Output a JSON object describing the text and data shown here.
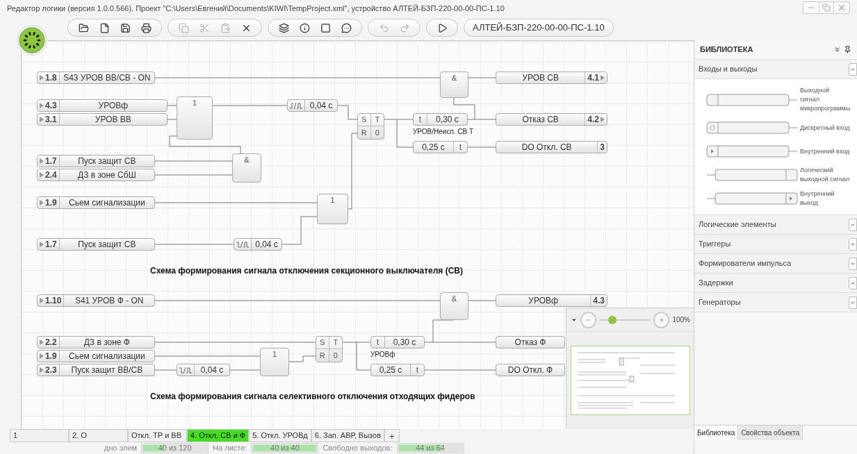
{
  "window": {
    "title": "Редактор логики (версия 1.0.0.566). Проект \"C:\\Users\\Евгений\\Documents\\KIWI\\TempProject.xml\", устройство АЛТЕЙ-БЗП-220-00-00-ПС-1.10"
  },
  "toolbar": {
    "groups": [
      {
        "buttons": [
          {
            "kind": "open",
            "disabled": false
          },
          {
            "kind": "new",
            "disabled": false
          },
          {
            "kind": "save",
            "disabled": false
          },
          {
            "kind": "print",
            "disabled": false
          }
        ]
      },
      {
        "buttons": [
          {
            "kind": "copy",
            "disabled": true
          },
          {
            "kind": "cut",
            "disabled": true
          },
          {
            "kind": "paste",
            "disabled": true
          },
          {
            "kind": "delete",
            "disabled": false
          }
        ]
      },
      {
        "buttons": [
          {
            "kind": "windows",
            "disabled": false
          },
          {
            "kind": "info",
            "disabled": false
          },
          {
            "kind": "frame",
            "disabled": false
          },
          {
            "kind": "comment",
            "disabled": false
          }
        ]
      },
      {
        "buttons": [
          {
            "kind": "undo",
            "disabled": true
          },
          {
            "kind": "redo",
            "disabled": true
          }
        ]
      },
      {
        "buttons": [
          {
            "kind": "run",
            "disabled": false
          }
        ]
      }
    ],
    "device": "АЛТЕЙ-БЗП-220-00-00-ПС-1.10"
  },
  "diagrams": [
    {
      "title": "Схема формирования сигнала отключения секционного выключателя (СВ)",
      "nodes": [
        {
          "kind": "input",
          "number": "1.8",
          "label": "S43 УРОВ ВВ/СВ - ON"
        },
        {
          "kind": "input",
          "number": "4.3",
          "label": "УРОВф"
        },
        {
          "kind": "input",
          "number": "3.1",
          "label": "УРОВ ВВ"
        },
        {
          "kind": "input",
          "number": "1.7",
          "label": "Пуск защит СВ"
        },
        {
          "kind": "input",
          "number": "2.4",
          "label": "ДЗ в зоне СбШ"
        },
        {
          "kind": "input",
          "number": "1.9",
          "label": "Сьем сигнализации"
        },
        {
          "kind": "input",
          "number": "1.7",
          "label": "Пуск защит СВ"
        },
        {
          "kind": "gate",
          "symbol": "1"
        },
        {
          "kind": "gate",
          "symbol": "&"
        },
        {
          "kind": "gate",
          "symbol": "1"
        },
        {
          "kind": "pulse_rising",
          "value": "0,04 с"
        },
        {
          "kind": "pulse_falling",
          "value": "0,04 с"
        },
        {
          "kind": "trigger",
          "cells": [
            "S",
            "T",
            "R",
            "0"
          ]
        },
        {
          "kind": "timer_on",
          "symbol": "t",
          "value": "0,30 с",
          "caption": "УРОВ/Неисп. СВ Т"
        },
        {
          "kind": "timer_off",
          "symbol": "t",
          "value": "0,25 с"
        },
        {
          "kind": "gate",
          "symbol": "&"
        },
        {
          "kind": "output",
          "label": "УРОВ СВ",
          "number": "4.1",
          "arrow": true
        },
        {
          "kind": "output",
          "label": "Отказ СВ",
          "number": "4.2",
          "arrow": true
        },
        {
          "kind": "output",
          "label": "DO Откл. СВ",
          "number": "3",
          "arrow": false
        }
      ]
    },
    {
      "title": "Схема формирования сигнала селективного отключения отходящих фидеров",
      "nodes": [
        {
          "kind": "input",
          "number": "1.10",
          "label": "S41 УРОВ Ф - ON"
        },
        {
          "kind": "input",
          "number": "2.2",
          "label": "ДЗ в зоне Ф"
        },
        {
          "kind": "input",
          "number": "1.9",
          "label": "Сьем сигнализации"
        },
        {
          "kind": "input",
          "number": "2.3",
          "label": "Пуск защит ВВ/СВ"
        },
        {
          "kind": "pulse_falling",
          "value": "0,04 с"
        },
        {
          "kind": "gate",
          "symbol": "1"
        },
        {
          "kind": "trigger",
          "cells": [
            "S",
            "T",
            "R",
            "0"
          ]
        },
        {
          "kind": "timer_on",
          "symbol": "t",
          "value": "0,30 с",
          "caption": "УРОВф"
        },
        {
          "kind": "timer_off",
          "symbol": "t",
          "value": "0,25 с"
        },
        {
          "kind": "gate",
          "symbol": "&"
        },
        {
          "kind": "output",
          "label": "УРОВф",
          "number": "4.3",
          "arrow": false
        },
        {
          "kind": "output",
          "label": "Отказ Ф"
        },
        {
          "kind": "output",
          "label": "DO Откл. Ф"
        }
      ]
    }
  ],
  "navigator": {
    "zoom": "100%",
    "level": 0.2
  },
  "sheet_tabs": [
    {
      "label": "1",
      "selected": false
    },
    {
      "label": "2. О",
      "selected": false
    },
    {
      "label": "Откл. ТР и ВВ",
      "selected": false
    },
    {
      "label": "4. Откл. СВ и Ф",
      "selected": true
    },
    {
      "label": "5. Откл. УРОВд",
      "selected": false
    },
    {
      "label": "6. Зап. АВР, Вызов",
      "selected": false
    }
  ],
  "add_tab": "+",
  "status_bar": [
    {
      "label": "дно элем",
      "value": "40 из 120",
      "level": 0.33
    },
    {
      "label": "На листе:",
      "value": "40 из 40",
      "level": 1
    },
    {
      "label": "Свободно выходов:",
      "value": "44 из 64",
      "level": 0.69
    }
  ],
  "library": {
    "title": "БИБЛИОТЕКА",
    "sections": [
      {
        "title": "Входы и выходы",
        "expanded": true,
        "items": [
          {
            "kind": "output_signal",
            "label": "Выходной сигнал микропрограммы"
          },
          {
            "kind": "discrete_input",
            "label": "Дискретный вход"
          },
          {
            "kind": "internal_input",
            "label": "Внутренний вход"
          },
          {
            "kind": "logic_output",
            "label": "Логический выходной сигнал"
          },
          {
            "kind": "internal_output",
            "label": "Внутренний выход"
          }
        ]
      },
      {
        "title": "Логические элементы",
        "expanded": false
      },
      {
        "title": "Триггеры",
        "expanded": false
      },
      {
        "title": "Формирователи импульса",
        "expanded": false
      },
      {
        "title": "Задержки",
        "expanded": false
      },
      {
        "title": "Генераторы",
        "expanded": false
      }
    ],
    "tabs": [
      {
        "label": "Библиотека",
        "selected": true
      },
      {
        "label": "Свойства объекта",
        "selected": false
      }
    ]
  }
}
